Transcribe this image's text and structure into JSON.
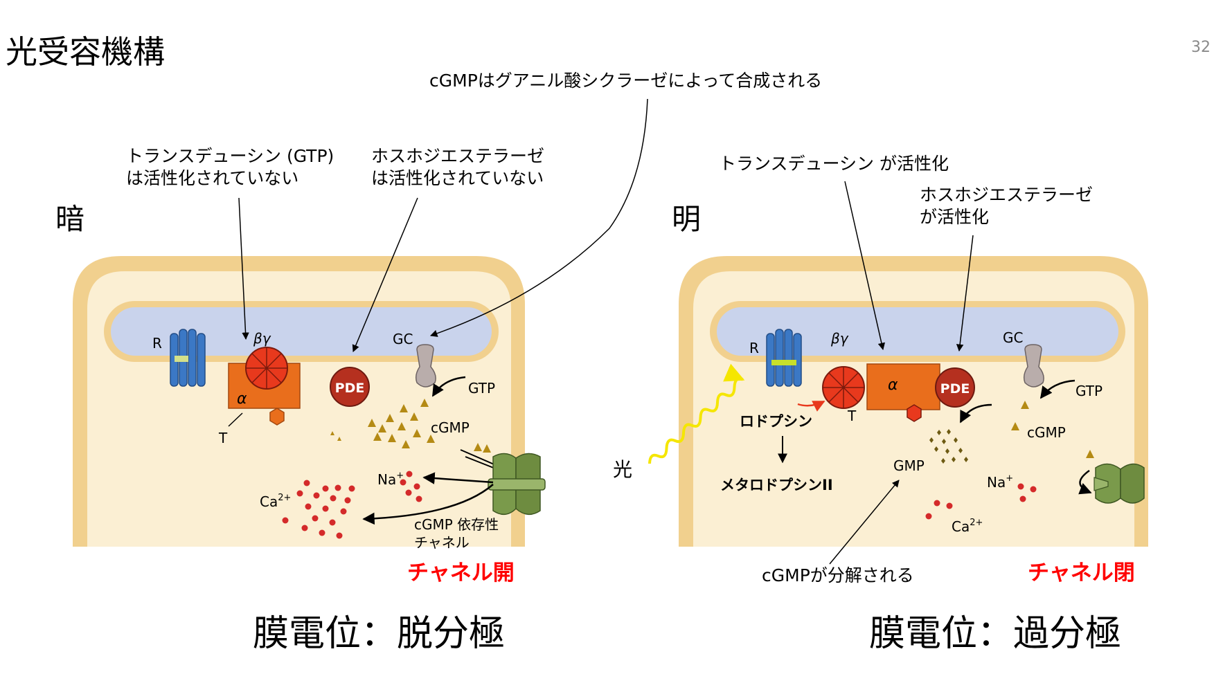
{
  "slide": {
    "title": "光受容機構",
    "number": "32"
  },
  "annotations": {
    "gc_synth": "cGMPはグアニル酸シクラーゼによって合成される",
    "dark_transducin_line1": "トランスデューシン (GTP)",
    "dark_transducin_line2": "は活性化されていない",
    "dark_pde_line1": "ホスホジエステラーゼ",
    "dark_pde_line2": "は活性化されていない",
    "light_transducin": "トランスデューシン が活性化",
    "light_pde_line1": "ホスホジエステラーゼ",
    "light_pde_line2": "が活性化",
    "cgmp_breakdown": "cGMPが分解される"
  },
  "dark_panel": {
    "state": "暗",
    "result": "チャネル開",
    "potential": "膜電位：脱分極",
    "labels": {
      "r": "R",
      "bg": "βγ",
      "alpha": "α",
      "t": "T",
      "pde": "PDE",
      "gc": "GC",
      "gtp": "GTP",
      "cgmp": "cGMP",
      "na": "Na",
      "ca": "Ca",
      "channel_line1": "cGMP 依存性",
      "channel_line2": "チャネル"
    }
  },
  "light_panel": {
    "state": "明",
    "result": "チャネル閉",
    "potential": "膜電位：過分極",
    "labels": {
      "r": "R",
      "bg": "βγ",
      "alpha": "α",
      "t": "T",
      "pde": "PDE",
      "gc": "GC",
      "gtp": "GTP",
      "cgmp": "cGMP",
      "gmp": "GMP",
      "na": "Na",
      "ca": "Ca",
      "light": "光",
      "rhodopsin": "ロドプシン",
      "metarhodopsin": "メタロドプシンII"
    }
  },
  "colors": {
    "cell_fill": "#fbefd3",
    "cell_border": "#f1d08e",
    "disc_fill": "#c9d3ec",
    "rhodopsin": "#3b78c5",
    "transducin_bg": "#e8391d",
    "transducin_alpha": "#e96e1c",
    "pde": "#b5301f",
    "gc": "#b9adab",
    "cgmp": "#b48a14",
    "ion": "#d42a2a",
    "channel": "#7a9a4b",
    "light": "#f5e600",
    "result_text": "#ff0000"
  }
}
